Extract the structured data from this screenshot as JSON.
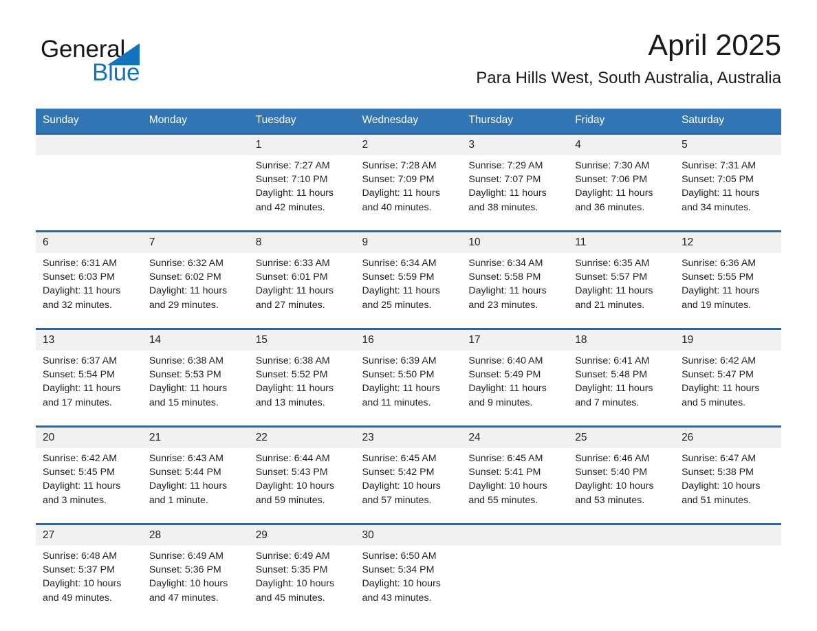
{
  "brand": {
    "name_part1": "General",
    "name_part2": "Blue",
    "triangle_color": "#1273bd",
    "text_color": "#161616"
  },
  "header": {
    "month_title": "April 2025",
    "location": "Para Hills West, South Australia, Australia"
  },
  "theme": {
    "header_bg": "#3175b4",
    "separator": "#1c6cb0",
    "daynum_bg": "#f1f1f1",
    "cell_bg": "#ffffff"
  },
  "weekday_headers": [
    "Sunday",
    "Monday",
    "Tuesday",
    "Wednesday",
    "Thursday",
    "Friday",
    "Saturday"
  ],
  "weeks": [
    {
      "days": [
        {
          "num": "",
          "l1": "",
          "l2": "",
          "l3": "",
          "l4": ""
        },
        {
          "num": "",
          "l1": "",
          "l2": "",
          "l3": "",
          "l4": ""
        },
        {
          "num": "1",
          "l1": "Sunrise: 7:27 AM",
          "l2": "Sunset: 7:10 PM",
          "l3": "Daylight: 11 hours",
          "l4": "and 42 minutes."
        },
        {
          "num": "2",
          "l1": "Sunrise: 7:28 AM",
          "l2": "Sunset: 7:09 PM",
          "l3": "Daylight: 11 hours",
          "l4": "and 40 minutes."
        },
        {
          "num": "3",
          "l1": "Sunrise: 7:29 AM",
          "l2": "Sunset: 7:07 PM",
          "l3": "Daylight: 11 hours",
          "l4": "and 38 minutes."
        },
        {
          "num": "4",
          "l1": "Sunrise: 7:30 AM",
          "l2": "Sunset: 7:06 PM",
          "l3": "Daylight: 11 hours",
          "l4": "and 36 minutes."
        },
        {
          "num": "5",
          "l1": "Sunrise: 7:31 AM",
          "l2": "Sunset: 7:05 PM",
          "l3": "Daylight: 11 hours",
          "l4": "and 34 minutes."
        }
      ]
    },
    {
      "days": [
        {
          "num": "6",
          "l1": "Sunrise: 6:31 AM",
          "l2": "Sunset: 6:03 PM",
          "l3": "Daylight: 11 hours",
          "l4": "and 32 minutes."
        },
        {
          "num": "7",
          "l1": "Sunrise: 6:32 AM",
          "l2": "Sunset: 6:02 PM",
          "l3": "Daylight: 11 hours",
          "l4": "and 29 minutes."
        },
        {
          "num": "8",
          "l1": "Sunrise: 6:33 AM",
          "l2": "Sunset: 6:01 PM",
          "l3": "Daylight: 11 hours",
          "l4": "and 27 minutes."
        },
        {
          "num": "9",
          "l1": "Sunrise: 6:34 AM",
          "l2": "Sunset: 5:59 PM",
          "l3": "Daylight: 11 hours",
          "l4": "and 25 minutes."
        },
        {
          "num": "10",
          "l1": "Sunrise: 6:34 AM",
          "l2": "Sunset: 5:58 PM",
          "l3": "Daylight: 11 hours",
          "l4": "and 23 minutes."
        },
        {
          "num": "11",
          "l1": "Sunrise: 6:35 AM",
          "l2": "Sunset: 5:57 PM",
          "l3": "Daylight: 11 hours",
          "l4": "and 21 minutes."
        },
        {
          "num": "12",
          "l1": "Sunrise: 6:36 AM",
          "l2": "Sunset: 5:55 PM",
          "l3": "Daylight: 11 hours",
          "l4": "and 19 minutes."
        }
      ]
    },
    {
      "days": [
        {
          "num": "13",
          "l1": "Sunrise: 6:37 AM",
          "l2": "Sunset: 5:54 PM",
          "l3": "Daylight: 11 hours",
          "l4": "and 17 minutes."
        },
        {
          "num": "14",
          "l1": "Sunrise: 6:38 AM",
          "l2": "Sunset: 5:53 PM",
          "l3": "Daylight: 11 hours",
          "l4": "and 15 minutes."
        },
        {
          "num": "15",
          "l1": "Sunrise: 6:38 AM",
          "l2": "Sunset: 5:52 PM",
          "l3": "Daylight: 11 hours",
          "l4": "and 13 minutes."
        },
        {
          "num": "16",
          "l1": "Sunrise: 6:39 AM",
          "l2": "Sunset: 5:50 PM",
          "l3": "Daylight: 11 hours",
          "l4": "and 11 minutes."
        },
        {
          "num": "17",
          "l1": "Sunrise: 6:40 AM",
          "l2": "Sunset: 5:49 PM",
          "l3": "Daylight: 11 hours",
          "l4": "and 9 minutes."
        },
        {
          "num": "18",
          "l1": "Sunrise: 6:41 AM",
          "l2": "Sunset: 5:48 PM",
          "l3": "Daylight: 11 hours",
          "l4": "and 7 minutes."
        },
        {
          "num": "19",
          "l1": "Sunrise: 6:42 AM",
          "l2": "Sunset: 5:47 PM",
          "l3": "Daylight: 11 hours",
          "l4": "and 5 minutes."
        }
      ]
    },
    {
      "days": [
        {
          "num": "20",
          "l1": "Sunrise: 6:42 AM",
          "l2": "Sunset: 5:45 PM",
          "l3": "Daylight: 11 hours",
          "l4": "and 3 minutes."
        },
        {
          "num": "21",
          "l1": "Sunrise: 6:43 AM",
          "l2": "Sunset: 5:44 PM",
          "l3": "Daylight: 11 hours",
          "l4": "and 1 minute."
        },
        {
          "num": "22",
          "l1": "Sunrise: 6:44 AM",
          "l2": "Sunset: 5:43 PM",
          "l3": "Daylight: 10 hours",
          "l4": "and 59 minutes."
        },
        {
          "num": "23",
          "l1": "Sunrise: 6:45 AM",
          "l2": "Sunset: 5:42 PM",
          "l3": "Daylight: 10 hours",
          "l4": "and 57 minutes."
        },
        {
          "num": "24",
          "l1": "Sunrise: 6:45 AM",
          "l2": "Sunset: 5:41 PM",
          "l3": "Daylight: 10 hours",
          "l4": "and 55 minutes."
        },
        {
          "num": "25",
          "l1": "Sunrise: 6:46 AM",
          "l2": "Sunset: 5:40 PM",
          "l3": "Daylight: 10 hours",
          "l4": "and 53 minutes."
        },
        {
          "num": "26",
          "l1": "Sunrise: 6:47 AM",
          "l2": "Sunset: 5:38 PM",
          "l3": "Daylight: 10 hours",
          "l4": "and 51 minutes."
        }
      ]
    },
    {
      "days": [
        {
          "num": "27",
          "l1": "Sunrise: 6:48 AM",
          "l2": "Sunset: 5:37 PM",
          "l3": "Daylight: 10 hours",
          "l4": "and 49 minutes."
        },
        {
          "num": "28",
          "l1": "Sunrise: 6:49 AM",
          "l2": "Sunset: 5:36 PM",
          "l3": "Daylight: 10 hours",
          "l4": "and 47 minutes."
        },
        {
          "num": "29",
          "l1": "Sunrise: 6:49 AM",
          "l2": "Sunset: 5:35 PM",
          "l3": "Daylight: 10 hours",
          "l4": "and 45 minutes."
        },
        {
          "num": "30",
          "l1": "Sunrise: 6:50 AM",
          "l2": "Sunset: 5:34 PM",
          "l3": "Daylight: 10 hours",
          "l4": "and 43 minutes."
        },
        {
          "num": "",
          "l1": "",
          "l2": "",
          "l3": "",
          "l4": ""
        },
        {
          "num": "",
          "l1": "",
          "l2": "",
          "l3": "",
          "l4": ""
        },
        {
          "num": "",
          "l1": "",
          "l2": "",
          "l3": "",
          "l4": ""
        }
      ]
    }
  ]
}
